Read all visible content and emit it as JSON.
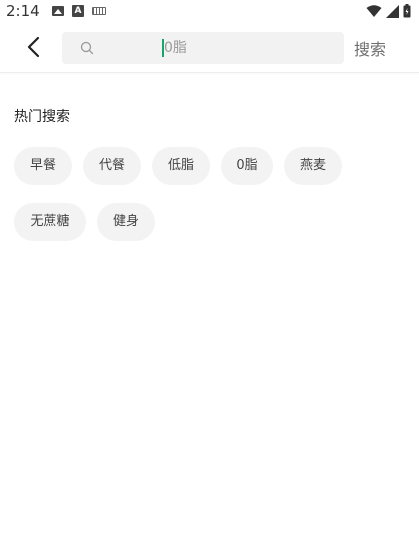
{
  "status_bar": {
    "time": "2:14",
    "left_icons": [
      "image-icon",
      "a-icon",
      "keyboard-icon"
    ],
    "right_icons": [
      "wifi-icon",
      "signal-icon",
      "battery-icon"
    ]
  },
  "header": {
    "back_icon": "chevron-left-icon",
    "search": {
      "icon": "search-icon",
      "placeholder": "0脂",
      "value": ""
    },
    "search_button_label": "搜索"
  },
  "hot_search": {
    "title": "热门搜索",
    "tags": [
      "早餐",
      "代餐",
      "低脂",
      "0脂",
      "燕麦",
      "无蔗糖",
      "健身"
    ]
  },
  "colors": {
    "accent_caret": "#1aa56a",
    "tag_background": "#f3f3f3",
    "search_background": "#f2f2f2"
  }
}
